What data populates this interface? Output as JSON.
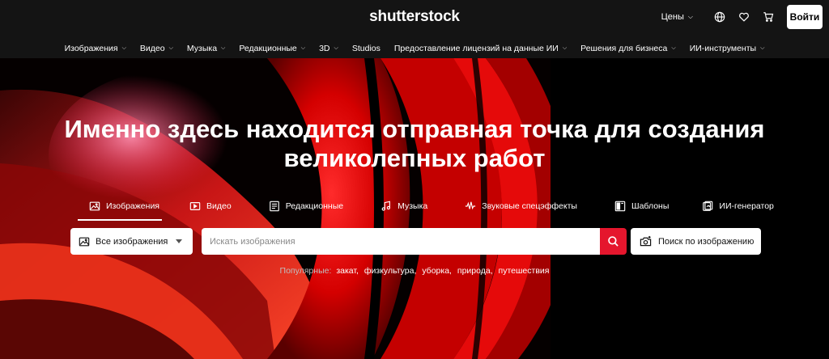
{
  "header": {
    "logo": "shutterstock",
    "pricing_label": "Цены",
    "login_label": "Войти",
    "icons": [
      "globe-icon",
      "heart-icon",
      "cart-icon"
    ]
  },
  "nav": {
    "items": [
      {
        "label": "Изображения"
      },
      {
        "label": "Видео"
      },
      {
        "label": "Музыка"
      },
      {
        "label": "Редакционные"
      },
      {
        "label": "3D"
      },
      {
        "label": "Studios"
      },
      {
        "label": "Предоставление лицензий на данные ИИ"
      },
      {
        "label": "Решения для бизнеса"
      },
      {
        "label": "ИИ-инструменты"
      }
    ]
  },
  "hero": {
    "headline_line1": "Именно здесь находится отправная точка для создания",
    "headline_line2": "великолепных работ"
  },
  "tabs": [
    {
      "label": "Изображения",
      "icon": "image-icon",
      "active": true
    },
    {
      "label": "Видео",
      "icon": "video-icon"
    },
    {
      "label": "Редакционные",
      "icon": "article-icon"
    },
    {
      "label": "Музыка",
      "icon": "music-note-icon"
    },
    {
      "label": "Звуковые спецэффекты",
      "icon": "soundwave-icon"
    },
    {
      "label": "Шаблоны",
      "icon": "template-icon"
    },
    {
      "label": "ИИ-генератор",
      "icon": "ai-generator-icon"
    }
  ],
  "search": {
    "type_selected": "Все изображения",
    "placeholder": "Искать изображения",
    "value": "",
    "image_search_label": "Поиск по изображению"
  },
  "popular": {
    "label": "Популярные:",
    "terms": [
      "закат",
      "физкультура",
      "уборка",
      "природа",
      "путешествия"
    ]
  },
  "colors": {
    "accent": "#e5162d",
    "topbar": "#141414",
    "background": "#000000"
  }
}
